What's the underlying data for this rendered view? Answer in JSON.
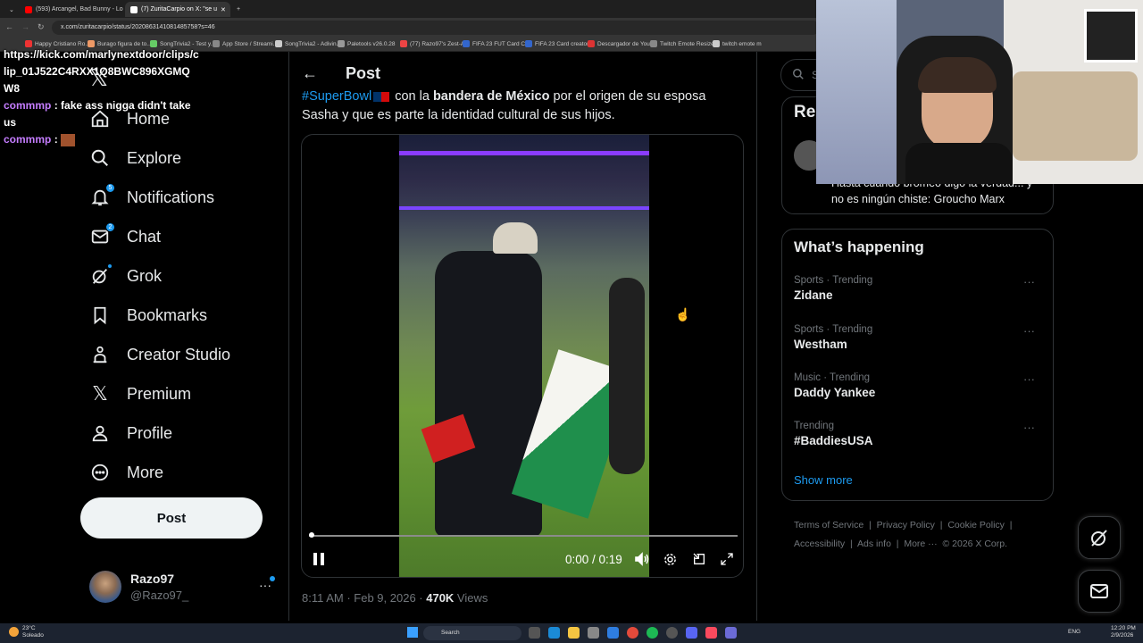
{
  "browser": {
    "tabs": [
      {
        "label": "(593) Arcangel, Bad Bunny - Lo",
        "active": false
      },
      {
        "label": "(7) ZuritaCarpio on X: \"se u",
        "active": true
      }
    ],
    "url": "x.com/zuritacarpio/status/2020863141081485758?s=46",
    "bookmarks": [
      "Happy Cristiano Ro...",
      "Burago figura de to...",
      "SongTrivia2 - Test y...",
      "App Store / Streami...",
      "SongTrivia2 - Adivin...",
      "Paletools v26.0.28",
      "(77) Razo97's Zest-A...",
      "FIFA 23 FUT Card Cr...",
      "FIFA 23 Card creator...",
      "Descargador de You...",
      "Twitch Emote Resizer",
      "twitch emote m"
    ]
  },
  "chat": [
    {
      "user": "",
      "text": "https://kick.com/marlynextdoor/clips/clip_01J522C4RXX1Q8BWC896XGMQW8"
    },
    {
      "user": "commmp",
      "text": ": fake ass nigga didn't take us"
    },
    {
      "user": "commmp",
      "text": ":"
    }
  ],
  "sidebar": {
    "items": [
      {
        "label": "Home",
        "icon": "home-icon"
      },
      {
        "label": "Explore",
        "icon": "search-icon"
      },
      {
        "label": "Notifications",
        "icon": "bell-icon",
        "badge": "5"
      },
      {
        "label": "Chat",
        "icon": "mail-icon",
        "badge": "2"
      },
      {
        "label": "Grok",
        "icon": "grok-icon"
      },
      {
        "label": "Bookmarks",
        "icon": "bookmark-icon"
      },
      {
        "label": "Creator Studio",
        "icon": "creator-icon"
      },
      {
        "label": "Premium",
        "icon": "x-logo-icon"
      },
      {
        "label": "Profile",
        "icon": "person-icon"
      },
      {
        "label": "More",
        "icon": "more-circle-icon"
      }
    ],
    "post_button": "Post",
    "account": {
      "name": "Razo97",
      "handle": "@Razo97_"
    }
  },
  "post": {
    "header": "Post",
    "text_hashtag": "#SuperBowl",
    "text_part1": " con la ",
    "text_bold": "bandera de México",
    "text_part2": " por el origen de su esposa Sasha y que es parte la identidad cultural de sus hijos.",
    "video_time": "0:00 / 0:19",
    "progress": 0,
    "time": "8:11 AM · Feb 9, 2026 · ",
    "views_count": "470K",
    "views_label": " Views"
  },
  "right": {
    "search_placeholder": "Se",
    "relevant_title": "Rel",
    "relevant_bio": "Hasta cuando bromeo digo la verdad... y no es ningún chiste: Groucho Marx",
    "whats_happening": "What’s happening",
    "trends": [
      {
        "category": "Sports · Trending",
        "name": "Zidane"
      },
      {
        "category": "Sports · Trending",
        "name": "Westham"
      },
      {
        "category": "Music · Trending",
        "name": "Daddy Yankee"
      },
      {
        "category": "Trending",
        "name": "#BaddiesUSA"
      }
    ],
    "show_more": "Show more",
    "footer_line1": "Terms of Service  |  Privacy Policy  |  Cookie Policy  |",
    "footer_line2": "Accessibility  |  Ads info  |  More ···  © 2026 X Corp."
  },
  "taskbar": {
    "weather_temp": "23°C",
    "weather_desc": "Soleado",
    "search": "Search",
    "lang": "ENG",
    "time": "12:20 PM",
    "date": "2/9/2026"
  },
  "colors": {
    "accent": "#1d9bf0",
    "background": "#000000",
    "border": "#2f3336",
    "muted": "#71767b"
  }
}
